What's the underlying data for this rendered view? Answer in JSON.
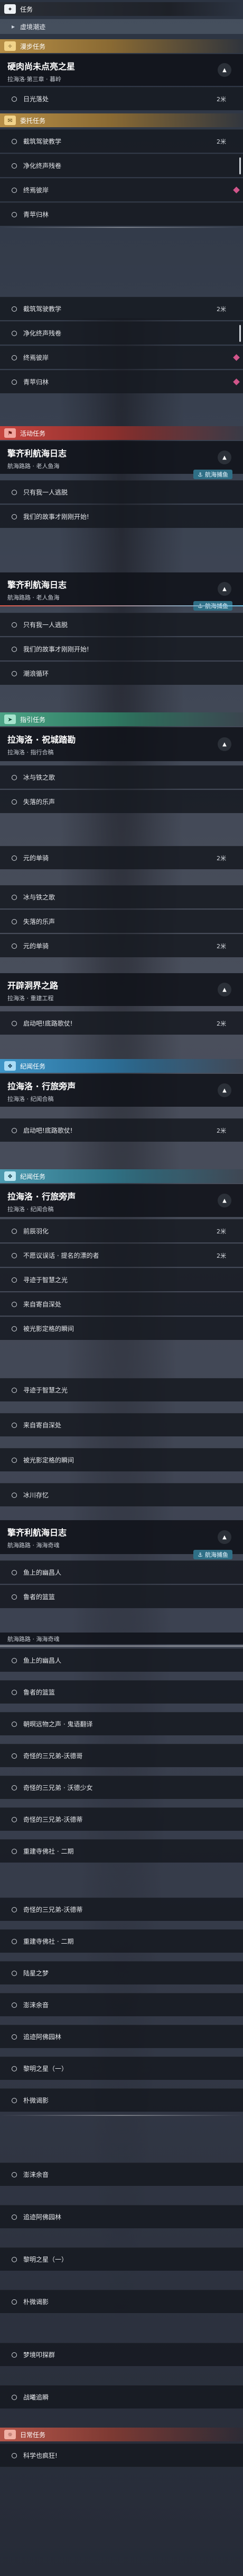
{
  "header": {
    "title": "任务",
    "active": "虚境潮迹"
  },
  "explore": {
    "label": "漫步任务",
    "quest": "硬肉尚未点亮之星",
    "sub": "拉海洛·第三章 · 暮岭",
    "item": "日光落处",
    "dist": "2米"
  },
  "sub": {
    "label": "委托任务",
    "items": [
      {
        "t": "截筑驾驶教学",
        "d": "2米"
      },
      {
        "t": "净化终声残卷",
        "d": ""
      },
      {
        "t": "终焉彼岸",
        "d": ""
      },
      {
        "t": "青苹归林",
        "d": ""
      },
      {
        "t": "截筑驾驶教学",
        "d": "2米"
      },
      {
        "t": "净化终声残卷",
        "d": ""
      },
      {
        "t": "终焉彼岸",
        "d": ""
      },
      {
        "t": "青苹归林",
        "d": ""
      }
    ]
  },
  "event": {
    "label": "活动任务",
    "quest": "擎齐利航海日志",
    "sub": "航海路路 · 老人鱼海",
    "tag": "航海捕鱼",
    "items": [
      "只有我一人逃脱",
      "我们的故事才刚刚开始!"
    ]
  },
  "event2": {
    "quest": "擎齐利航海日志",
    "sub": "航海路路 · 老人鱼海",
    "tag": "航海捕鱼",
    "items": [
      "只有我一人逃脱",
      "我们的故事才刚刚开始!",
      "潮浪循环"
    ]
  },
  "side": {
    "label": "指引任务",
    "quest": "拉海洛 · 祝城踏勘",
    "sub": "拉海洛 · 指行合稿",
    "items": [
      "冰与铁之歌",
      "失落的乐声",
      "元的单骑",
      "冰与铁之歌",
      "失落的乐声",
      "元的单骑"
    ],
    "dists": [
      "",
      "",
      "2米",
      "",
      "",
      "2米"
    ]
  },
  "gate": {
    "quest": "开辟洞界之路",
    "sub": "拉海洛 · 重建工程",
    "items": [
      "启动吧!底路歌仗!"
    ],
    "dist": "2米"
  },
  "story": {
    "label": "纪闻任务",
    "quest": "拉海洛 · 行旅旁声",
    "sub": "拉海洛 · 纪闻合稿",
    "items": [
      "启动吧!底路歌仗!"
    ],
    "dist": "2米"
  },
  "story2": {
    "label": "纪闻任务",
    "quest": "拉海洛 · 行旅旁声",
    "sub": "拉海洛 · 纪闻合稿",
    "items": [
      "前辰羽化",
      "不愿议误话 · 提名的漂的者",
      "寻迹于智慧之光",
      "来自寄自深处",
      "被光影定格的瞬间",
      "寻迹于智慧之光",
      "来自寄自深处",
      "被光影定格的瞬间",
      "冰川存忆"
    ],
    "dists": [
      "2米",
      "2米",
      "",
      "",
      "",
      "",
      "",
      "",
      ""
    ]
  },
  "log": {
    "quest": "擎齐利航海日志",
    "sub": "航海路路 · 海海奇魂",
    "tag": "航海捕鱼",
    "items": [
      "鱼上的幽昌人",
      "鲁者的篮篮"
    ]
  },
  "log2": {
    "sub": "航海路路 · 海海奇魂",
    "items": [
      "鱼上的幽昌人",
      "鲁者的篮篮",
      "朝暝远物之声 · 鬼语翻译",
      "奇怪的三兄弟-沃德哥",
      "奇怪的三兄弟 · 沃德少女",
      "奇怪的三兄弟-沃德蒂",
      "重建寺佛社 · 二期",
      "奇怪的三兄弟-沃德蒂",
      "重建寺佛社 · 二期",
      "陆星之梦",
      "澎涞余音",
      "追迹阿佛园林",
      "黎明之星（一）",
      "朴微谒影",
      "澎涞余音",
      "追迹阿佛园林",
      "黎明之星（一）",
      "朴微谒影",
      "梦境叩探群",
      "战曦追瞬"
    ]
  },
  "daily": {
    "label": "日常任务",
    "items": [
      "科学也疯狂!"
    ]
  }
}
